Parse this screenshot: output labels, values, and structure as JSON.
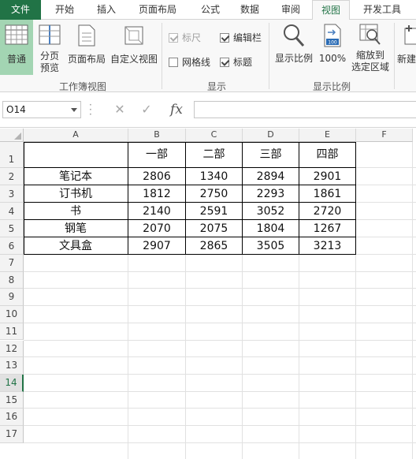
{
  "tabs": [
    "文件",
    "开始",
    "插入",
    "页面布局",
    "公式",
    "数据",
    "审阅",
    "视图",
    "开发工具"
  ],
  "ribbon": {
    "workbook_views": {
      "normal": "普通",
      "page_break": [
        "分页",
        "预览"
      ],
      "page_layout": "页面布局",
      "custom": "自定义视图",
      "label": "工作簿视图"
    },
    "show": {
      "ruler": "标尺",
      "formula_bar": "编辑栏",
      "gridlines": "网格线",
      "headings": "标题",
      "label": "显示"
    },
    "zoom": {
      "zoom": "显示比例",
      "hundred": "100%",
      "icon_text": "100",
      "to_selection": [
        "缩放到",
        "选定区域"
      ],
      "label": "显示比例"
    },
    "new_window": "新建"
  },
  "formula_bar": {
    "name_box": "O14",
    "cancel_glyph": "✕",
    "enter_glyph": "✓",
    "fx_glyph": "fx",
    "value": ""
  },
  "columns": [
    "A",
    "B",
    "C",
    "D",
    "E",
    "F"
  ],
  "rows": [
    "1",
    "2",
    "3",
    "4",
    "5",
    "6",
    "7",
    "8",
    "9",
    "10",
    "11",
    "12",
    "13",
    "14",
    "15",
    "16",
    "17"
  ],
  "active_row": "14",
  "table": {
    "headers": [
      "一部",
      "二部",
      "三部",
      "四部"
    ],
    "rows": [
      {
        "name": "笔记本",
        "values": [
          "2806",
          "1340",
          "2894",
          "2901"
        ]
      },
      {
        "name": "订书机",
        "values": [
          "1812",
          "2750",
          "2293",
          "1861"
        ]
      },
      {
        "name": "书",
        "values": [
          "2140",
          "2591",
          "3052",
          "2720"
        ]
      },
      {
        "name": "钢笔",
        "values": [
          "2070",
          "2075",
          "1804",
          "1267"
        ]
      },
      {
        "name": "文具盒",
        "values": [
          "2907",
          "2865",
          "3505",
          "3213"
        ]
      }
    ]
  },
  "colors": {
    "accent": "#217346",
    "selected_button": "#a3d5b3"
  }
}
